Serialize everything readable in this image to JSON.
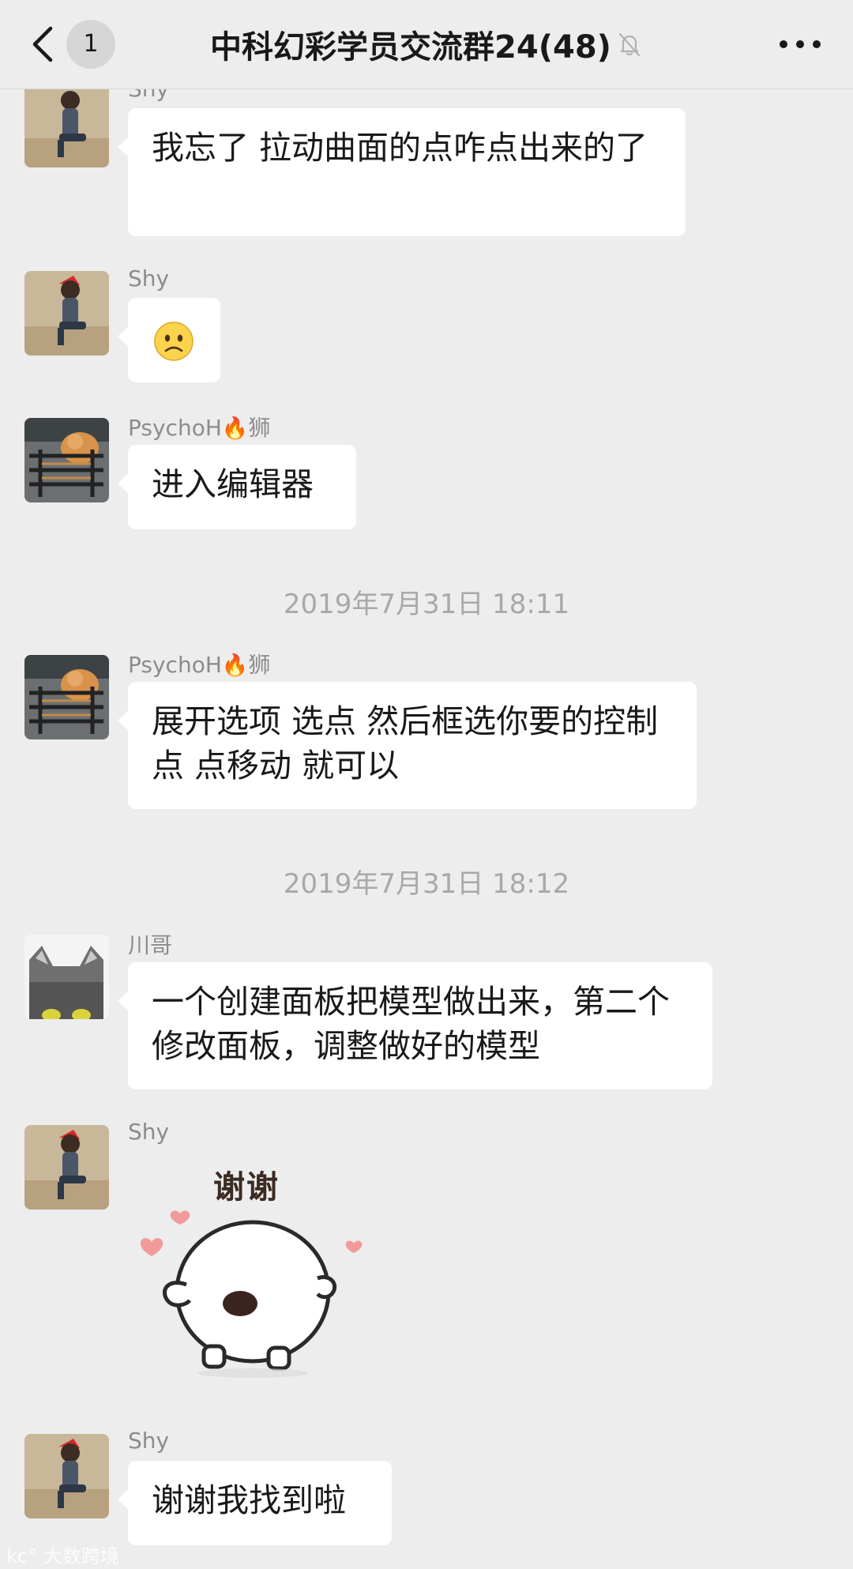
{
  "header": {
    "unread_count": "1",
    "title": "中科幻彩学员交流群24(48)",
    "icons": [
      "back-chevron-icon",
      "mute-bell-icon",
      "more-dots-icon"
    ]
  },
  "timestamps": [
    "2019年7月31日 18:11",
    "2019年7月31日 18:12"
  ],
  "messages": [
    {
      "sender": "Shy",
      "text": "我忘了 拉动曲面的点咋点出来的了"
    },
    {
      "sender": "Shy",
      "emoji": "🙁"
    },
    {
      "sender": "PsychoH",
      "sender_suffix": "狮",
      "text": "进入编辑器"
    },
    {
      "sender": "PsychoH",
      "sender_suffix": "狮",
      "text": "展开选项 选点 然后框选你要的控制点 点移动 就可以"
    },
    {
      "sender": "川哥",
      "text": "一个创建面板把模型做出来，第二个修改面板，调整做好的模型"
    },
    {
      "sender": "Shy",
      "sticker_text": "谢谢"
    },
    {
      "sender": "Shy",
      "text": "谢谢我找到啦"
    }
  ],
  "watermark": "大数跨境",
  "colors": {
    "background": "#ededed",
    "bubble": "#ffffff",
    "sender_name": "#8c8c8c",
    "timestamp": "#a8a8a8",
    "text": "#191919"
  }
}
